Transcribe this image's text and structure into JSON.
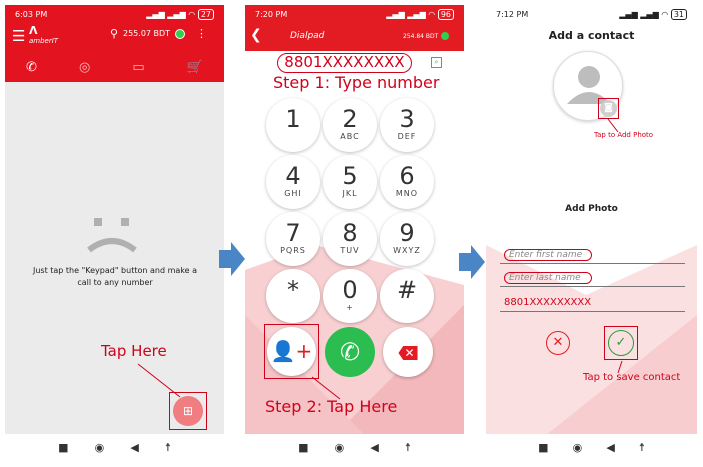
{
  "colors": {
    "brand_red": "#e3141f",
    "header_red": "#e31b23",
    "arrow_blue": "#4a86c5",
    "annotation_red": "#d0021b",
    "call_green": "#2bbd4f"
  },
  "screen1": {
    "status_time": "6:03 PM",
    "status_battery": "27",
    "app_name": "amberIT",
    "balance": "255.07 BDT",
    "tabs": [
      "phone-icon",
      "contacts-icon",
      "message-icon",
      "cart-icon"
    ],
    "empty_message": "Just tap the \"Keypad\" button and make a call to any number",
    "annotation": "Tap Here"
  },
  "screen2": {
    "status_time": "7:20 PM",
    "status_battery": "96",
    "title": "Dialpad",
    "balance": "254.84 BDT",
    "number": "8801XXXXXXXX",
    "step1": "Step 1: Type number",
    "step2": "Step 2: Tap Here",
    "keys": [
      {
        "digit": "1",
        "letters": ""
      },
      {
        "digit": "2",
        "letters": "ABC"
      },
      {
        "digit": "3",
        "letters": "DEF"
      },
      {
        "digit": "4",
        "letters": "GHI"
      },
      {
        "digit": "5",
        "letters": "JKL"
      },
      {
        "digit": "6",
        "letters": "MNO"
      },
      {
        "digit": "7",
        "letters": "PQRS"
      },
      {
        "digit": "8",
        "letters": "TUV"
      },
      {
        "digit": "9",
        "letters": "WXYZ"
      },
      {
        "digit": "*",
        "letters": ""
      },
      {
        "digit": "0",
        "letters": "+"
      },
      {
        "digit": "#",
        "letters": ""
      }
    ]
  },
  "screen3": {
    "status_time": "7:12 PM",
    "status_battery": "31",
    "title": "Add a contact",
    "photo_annotation": "Tap to Add Photo",
    "add_photo_label": "Add Photo",
    "first_name_placeholder": "Enter first name",
    "last_name_placeholder": "Enter last name",
    "number_value": "8801XXXXXXXXX",
    "save_annotation": "Tap to save contact"
  }
}
